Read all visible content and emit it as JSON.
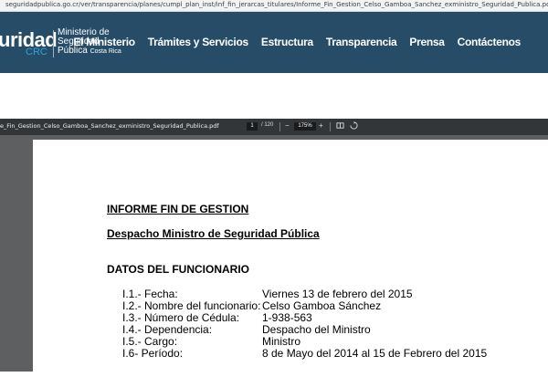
{
  "browser": {
    "url": "seguridadpublica.go.cr/ver/transparencia/planes/cumpl_plan_inst/inf_fin_jerarcas_titulares/Informe_Fin_Gestion_Celso_Gamboa_Sanchez_exministro_Seguridad_Publica.pdf"
  },
  "site": {
    "logo": {
      "word": "uridad",
      "crc": "CRC",
      "ministry_line1": "Ministerio de",
      "ministry_line2": "Seguridad",
      "ministry_line3": "Pública",
      "country": "Costa Rica"
    },
    "nav": [
      "El Ministerio",
      "Trámites y Servicios",
      "Estructura",
      "Transparencia",
      "Prensa",
      "Contáctenos"
    ]
  },
  "pdf_viewer": {
    "file_name": "e_Fin_Gestion_Celso_Gamboa_Sanchez_exministro_Seguridad_Publica.pdf",
    "current_page": "1",
    "total_pages": "/ 120",
    "zoom": "175%",
    "zoom_out": "−",
    "zoom_in": "+"
  },
  "document": {
    "title": "INFORME FIN DE GESTION",
    "subtitle": "Despacho Ministro de Seguridad Pública",
    "section": "DATOS DEL FUNCIONARIO",
    "rows": [
      {
        "label": "I.1.- Fecha:",
        "value": "Viernes 13 de febrero del 2015"
      },
      {
        "label": "I.2.- Nombre del funcionario:",
        "value": "Celso Gamboa Sánchez"
      },
      {
        "label": "I.3.- Número de Cédula:",
        "value": "1-938-563"
      },
      {
        "label": "I.4.- Dependencia:",
        "value": "Despacho del Ministro"
      },
      {
        "label": "I.5.- Cargo:",
        "value": "Ministro"
      },
      {
        "label": "I.6- Período:",
        "value": "8 de Mayo del 2014 al 15 de Febrero del 2015"
      }
    ]
  }
}
